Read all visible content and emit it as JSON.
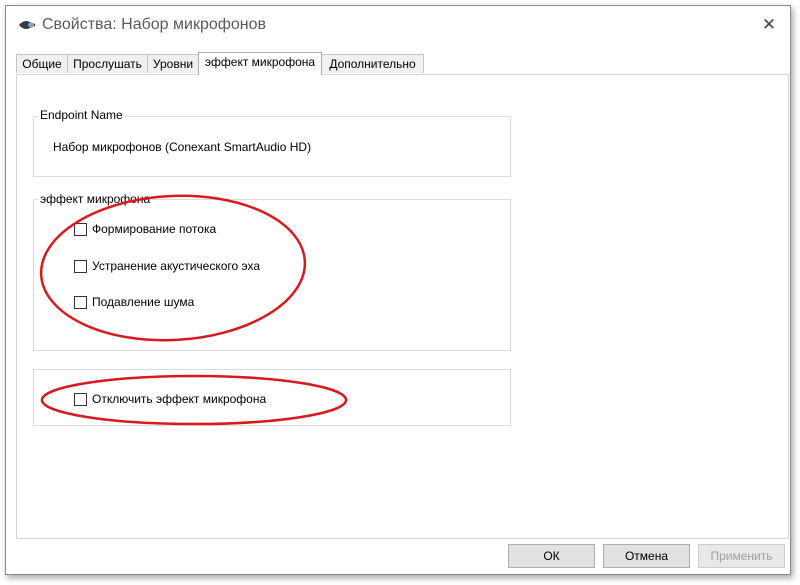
{
  "window": {
    "title": "Свойства: Набор микрофонов",
    "close_symbol": "✕"
  },
  "tabs": [
    {
      "label": "Общие"
    },
    {
      "label": "Прослушать"
    },
    {
      "label": "Уровни"
    },
    {
      "label": "эффект микрофона",
      "active": true
    },
    {
      "label": "Дополнительно"
    }
  ],
  "endpoint": {
    "group_label": "Endpoint Name",
    "device_name": "Набор микрофонов (Conexant SmartAudio HD)"
  },
  "effects": {
    "group_label": "эффект микрофона",
    "options": [
      {
        "label": "Формирование потока",
        "checked": false
      },
      {
        "label": "Устранение акустического эха",
        "checked": false
      },
      {
        "label": "Подавление шума",
        "checked": false
      }
    ]
  },
  "disable": {
    "label": "Отключить эффект микрофона",
    "checked": false
  },
  "buttons": {
    "ok": "ОК",
    "cancel": "Отмена",
    "apply": "Применить"
  },
  "colors": {
    "annotation_red": "#d9191e"
  },
  "icons": {
    "title": "microphone-icon",
    "close": "close-icon"
  }
}
